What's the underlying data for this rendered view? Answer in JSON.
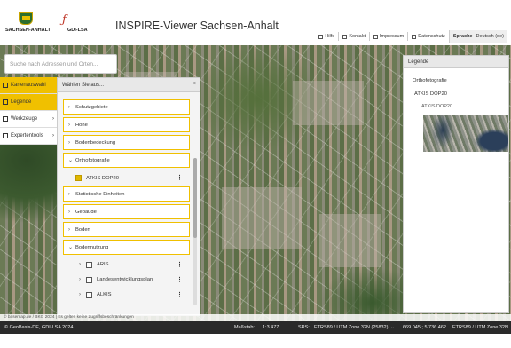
{
  "header": {
    "logo1_text": "SACHSEN-ANHALT",
    "logo2_text": "GDI-LSA",
    "title": "INSPIRE-Viewer Sachsen-Anhalt",
    "nav": [
      "Hilfe",
      "Kontakt",
      "Impressum",
      "Datenschutz"
    ],
    "lang_label": "Sprache",
    "lang_value": "Deutsch (de)"
  },
  "search": {
    "placeholder": "Suche nach Adressen und Orten..."
  },
  "sidemenu": {
    "items": [
      {
        "label": "Kartenauswahl",
        "icon": "map-icon"
      },
      {
        "label": "Legende",
        "icon": "legend-icon"
      },
      {
        "label": "Werkzeuge",
        "icon": "wrench-icon"
      },
      {
        "label": "Expertentools",
        "icon": "gear-icon"
      }
    ]
  },
  "panel": {
    "title": "Wählen Sie aus...",
    "layers": {
      "schutzgebiete": "Schutzgebiete",
      "hoehe": "Höhe",
      "bodenbedeckung": "Bodenbedeckung",
      "orthofotografie": "Orthofotografie",
      "atkis_dop20": "ATKIS DOP20",
      "statistische": "Statistische Einheiten",
      "gebaeude": "Gebäude",
      "boden": "Boden",
      "bodennutzung": "Bodennutzung",
      "aris": "ARIS",
      "landesentwicklungsplan": "Landesentwicklungsplan",
      "alkis": "ALKIS"
    }
  },
  "legend": {
    "title": "Legende",
    "group": "Orthofotografie",
    "layer": "ATKIS DOP20",
    "sublayer": "ATKIS DOP20"
  },
  "attribution": "© basemap.de / BKG 2024 | Es gelten keine Zugriffsbeschränkungen",
  "footer": {
    "copyright": "© GeoBasis-DE, GDI-LSA 2024",
    "scale_label": "Maßstab:",
    "scale_value": "1:3.477",
    "srs_label": "SRS:",
    "srs_value": "ETRS89 / UTM Zone 32N (25832)",
    "coords": "669.045 ; 5.736.462",
    "srs_value2": "ETRS89 / UTM Zone 32N"
  },
  "colors": {
    "accent": "#f0c000",
    "footer_bg": "#2a2a2a"
  }
}
